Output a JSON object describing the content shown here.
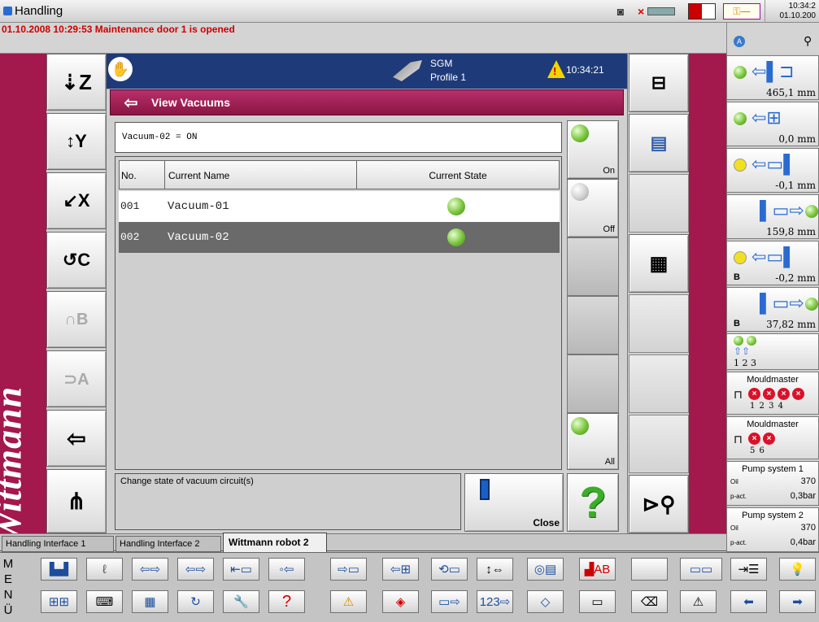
{
  "window": {
    "title": "Handling",
    "clock_time": "10:34:2",
    "clock_date": "01.10.200"
  },
  "alarm_bar": {
    "message": "01.10.2008 10:29:53  Maintenance door 1 is opened"
  },
  "brand": "Wittmann",
  "header": {
    "machine": "SGM",
    "profile": "Profile 1",
    "time": "10:34:21"
  },
  "panel": {
    "title": "View Vacuums",
    "status": "Vacuum-02 = ON"
  },
  "table": {
    "columns": [
      "No.",
      "Current Name",
      "Current State"
    ],
    "rows": [
      {
        "no": "001",
        "name": "Vacuum-01",
        "state": "on"
      },
      {
        "no": "002",
        "name": "Vacuum-02",
        "state": "on"
      }
    ]
  },
  "side_buttons": {
    "on": "On",
    "off": "Off",
    "all": "All"
  },
  "help_text": "Change state of vacuum circuit(s)",
  "close_label": "Close",
  "tabs": [
    "Handling Interface 1",
    "Handling Interface 2",
    "Wittmann robot 2"
  ],
  "axes": [
    {
      "name": "Z",
      "value": "465,1 mm"
    },
    {
      "name": "Y",
      "value": "0,0 mm"
    },
    {
      "name": "X",
      "value": "-0,1 mm"
    },
    {
      "name": "C",
      "value": "159,8 mm"
    },
    {
      "name": "B",
      "label": "B",
      "value": "-0,2 mm"
    },
    {
      "name": "A",
      "label": "B",
      "value": "37,82 mm"
    }
  ],
  "gripper_nums": "1  2  3",
  "mouldmaster1": {
    "title": "Mouldmaster",
    "nums": "1  2  3  4"
  },
  "mouldmaster2": {
    "title": "Mouldmaster",
    "nums": "5  6"
  },
  "pump1": {
    "title": "Pump system 1",
    "oil_label": "Oil",
    "oil_val": "370",
    "pact_label": "p-act.",
    "pact_val": "0,3bar"
  },
  "pump2": {
    "title": "Pump system 2",
    "oil_label": "Oil",
    "oil_val": "370",
    "pact_label": "p-act.",
    "pact_val": "0,4bar"
  },
  "menu_letters": [
    "M",
    "E",
    "N",
    "Ü"
  ],
  "colors": {
    "maroon": "#a3184d",
    "header_blue": "#1e3a78",
    "selected_row": "#6a6a6a"
  }
}
